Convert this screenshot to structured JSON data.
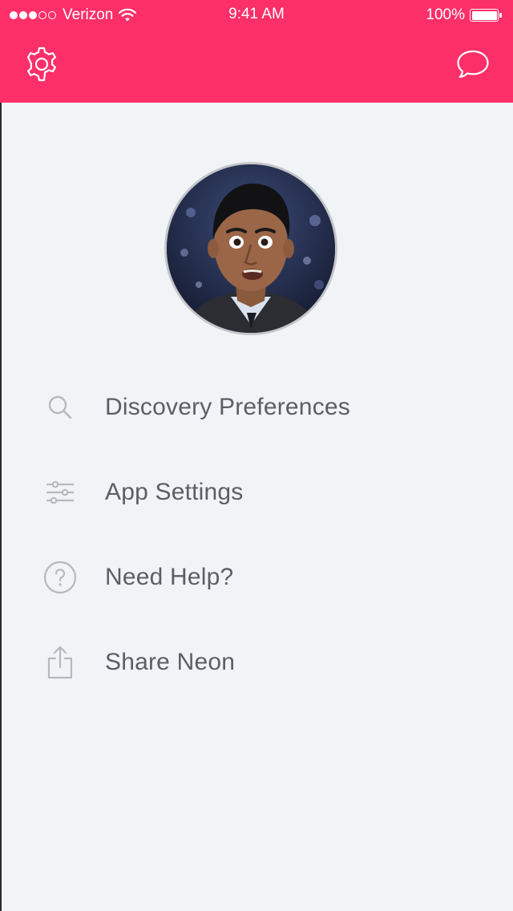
{
  "status_bar": {
    "carrier": "Verizon",
    "time": "9:41 AM",
    "battery_percent": "100%",
    "battery_level": 1.0,
    "signal_bars_filled": 3,
    "signal_bars_total": 5
  },
  "nav": {
    "left_icon": "gear-icon",
    "right_icon": "chat-bubble-icon"
  },
  "profile": {
    "avatar_icon": "profile-photo"
  },
  "menu": {
    "items": [
      {
        "label": "Discovery Preferences",
        "icon": "search-icon"
      },
      {
        "label": "App Settings",
        "icon": "sliders-icon"
      },
      {
        "label": "Need Help?",
        "icon": "help-circle-icon"
      },
      {
        "label": "Share Neon",
        "icon": "share-icon"
      }
    ]
  },
  "colors": {
    "brand": "#fd2f68",
    "background": "#f1f4f7",
    "menu_text": "#5b5e66",
    "menu_icon": "#b6b9be"
  }
}
